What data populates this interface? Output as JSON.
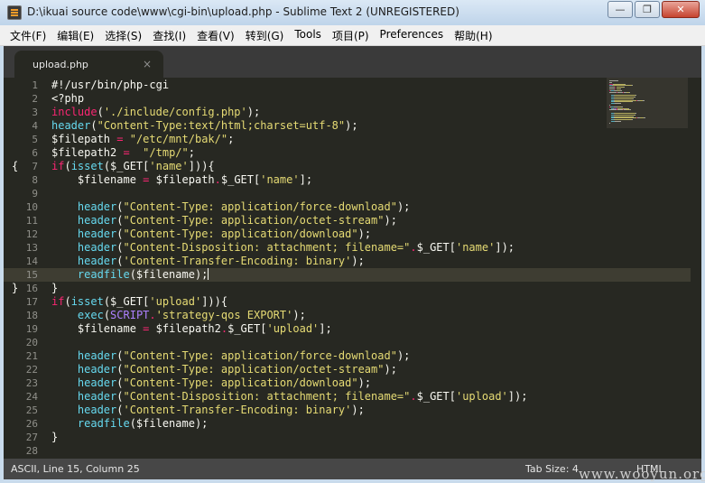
{
  "window": {
    "title": "D:\\ikuai source code\\www\\cgi-bin\\upload.php - Sublime Text 2 (UNREGISTERED)",
    "controls": {
      "minimize": "—",
      "maximize": "❐",
      "close": "✕"
    }
  },
  "menu": [
    "文件(F)",
    "编辑(E)",
    "选择(S)",
    "查找(I)",
    "查看(V)",
    "转到(G)",
    "Tools",
    "项目(P)",
    "Preferences",
    "帮助(H)"
  ],
  "tab": {
    "label": "upload.php",
    "close": "×"
  },
  "editor": {
    "current_line": 15,
    "fold_markers": [
      {
        "line": 7,
        "glyph": "{"
      },
      {
        "line": 16,
        "glyph": "}"
      }
    ],
    "lines": [
      [
        {
          "t": "#!/usr/bin/php-cgi",
          "c": "cm"
        }
      ],
      [
        {
          "t": "<?php",
          "c": "vr"
        }
      ],
      [
        {
          "t": "include",
          "c": "kw"
        },
        {
          "t": "(",
          "c": "vr"
        },
        {
          "t": "'./include/config.php'",
          "c": "st"
        },
        {
          "t": ");",
          "c": "vr"
        }
      ],
      [
        {
          "t": "header",
          "c": "fn"
        },
        {
          "t": "(",
          "c": "vr"
        },
        {
          "t": "\"Content-Type:text/html;charset=utf-8\"",
          "c": "st"
        },
        {
          "t": ");",
          "c": "vr"
        }
      ],
      [
        {
          "t": "$filepath ",
          "c": "vr"
        },
        {
          "t": "=",
          "c": "op"
        },
        {
          "t": " ",
          "c": "vr"
        },
        {
          "t": "\"/etc/mnt/bak/\"",
          "c": "st"
        },
        {
          "t": ";",
          "c": "vr"
        }
      ],
      [
        {
          "t": "$filepath2 ",
          "c": "vr"
        },
        {
          "t": "=",
          "c": "op"
        },
        {
          "t": "  ",
          "c": "vr"
        },
        {
          "t": "\"/tmp/\"",
          "c": "st"
        },
        {
          "t": ";",
          "c": "vr"
        }
      ],
      [
        {
          "t": "if",
          "c": "kw"
        },
        {
          "t": "(",
          "c": "vr"
        },
        {
          "t": "isset",
          "c": "fn"
        },
        {
          "t": "($_GET[",
          "c": "vr"
        },
        {
          "t": "'name'",
          "c": "st"
        },
        {
          "t": "])){",
          "c": "vr"
        }
      ],
      [
        {
          "t": "    $filename ",
          "c": "vr"
        },
        {
          "t": "=",
          "c": "op"
        },
        {
          "t": " $filepath",
          "c": "vr"
        },
        {
          "t": ".",
          "c": "op"
        },
        {
          "t": "$_GET[",
          "c": "vr"
        },
        {
          "t": "'name'",
          "c": "st"
        },
        {
          "t": "];",
          "c": "vr"
        }
      ],
      [],
      [
        {
          "t": "    ",
          "c": "vr"
        },
        {
          "t": "header",
          "c": "fn"
        },
        {
          "t": "(",
          "c": "vr"
        },
        {
          "t": "\"Content-Type: application/force-download\"",
          "c": "st"
        },
        {
          "t": ");",
          "c": "vr"
        }
      ],
      [
        {
          "t": "    ",
          "c": "vr"
        },
        {
          "t": "header",
          "c": "fn"
        },
        {
          "t": "(",
          "c": "vr"
        },
        {
          "t": "\"Content-Type: application/octet-stream\"",
          "c": "st"
        },
        {
          "t": ");",
          "c": "vr"
        }
      ],
      [
        {
          "t": "    ",
          "c": "vr"
        },
        {
          "t": "header",
          "c": "fn"
        },
        {
          "t": "(",
          "c": "vr"
        },
        {
          "t": "\"Content-Type: application/download\"",
          "c": "st"
        },
        {
          "t": ");",
          "c": "vr"
        }
      ],
      [
        {
          "t": "    ",
          "c": "vr"
        },
        {
          "t": "header",
          "c": "fn"
        },
        {
          "t": "(",
          "c": "vr"
        },
        {
          "t": "\"Content-Disposition: attachment; filename=\"",
          "c": "st"
        },
        {
          "t": ".",
          "c": "op"
        },
        {
          "t": "$_GET[",
          "c": "vr"
        },
        {
          "t": "'name'",
          "c": "st"
        },
        {
          "t": "]);",
          "c": "vr"
        }
      ],
      [
        {
          "t": "    ",
          "c": "vr"
        },
        {
          "t": "header",
          "c": "fn"
        },
        {
          "t": "(",
          "c": "vr"
        },
        {
          "t": "'Content-Transfer-Encoding: binary'",
          "c": "st"
        },
        {
          "t": ");",
          "c": "vr"
        }
      ],
      [
        {
          "t": "    ",
          "c": "vr"
        },
        {
          "t": "readfile",
          "c": "fn"
        },
        {
          "t": "($filename);",
          "c": "vr"
        }
      ],
      [
        {
          "t": "}",
          "c": "vr"
        }
      ],
      [
        {
          "t": "if",
          "c": "kw"
        },
        {
          "t": "(",
          "c": "vr"
        },
        {
          "t": "isset",
          "c": "fn"
        },
        {
          "t": "($_GET[",
          "c": "vr"
        },
        {
          "t": "'upload'",
          "c": "st"
        },
        {
          "t": "])){",
          "c": "vr"
        }
      ],
      [
        {
          "t": "    ",
          "c": "vr"
        },
        {
          "t": "exec",
          "c": "fn"
        },
        {
          "t": "(",
          "c": "vr"
        },
        {
          "t": "SCRIPT",
          "c": "cn"
        },
        {
          "t": ".",
          "c": "op"
        },
        {
          "t": "'strategy-qos EXPORT'",
          "c": "st"
        },
        {
          "t": ");",
          "c": "vr"
        }
      ],
      [
        {
          "t": "    $filename ",
          "c": "vr"
        },
        {
          "t": "=",
          "c": "op"
        },
        {
          "t": " $filepath2",
          "c": "vr"
        },
        {
          "t": ".",
          "c": "op"
        },
        {
          "t": "$_GET[",
          "c": "vr"
        },
        {
          "t": "'upload'",
          "c": "st"
        },
        {
          "t": "];",
          "c": "vr"
        }
      ],
      [],
      [
        {
          "t": "    ",
          "c": "vr"
        },
        {
          "t": "header",
          "c": "fn"
        },
        {
          "t": "(",
          "c": "vr"
        },
        {
          "t": "\"Content-Type: application/force-download\"",
          "c": "st"
        },
        {
          "t": ");",
          "c": "vr"
        }
      ],
      [
        {
          "t": "    ",
          "c": "vr"
        },
        {
          "t": "header",
          "c": "fn"
        },
        {
          "t": "(",
          "c": "vr"
        },
        {
          "t": "\"Content-Type: application/octet-stream\"",
          "c": "st"
        },
        {
          "t": ");",
          "c": "vr"
        }
      ],
      [
        {
          "t": "    ",
          "c": "vr"
        },
        {
          "t": "header",
          "c": "fn"
        },
        {
          "t": "(",
          "c": "vr"
        },
        {
          "t": "\"Content-Type: application/download\"",
          "c": "st"
        },
        {
          "t": ");",
          "c": "vr"
        }
      ],
      [
        {
          "t": "    ",
          "c": "vr"
        },
        {
          "t": "header",
          "c": "fn"
        },
        {
          "t": "(",
          "c": "vr"
        },
        {
          "t": "\"Content-Disposition: attachment; filename=\"",
          "c": "st"
        },
        {
          "t": ".",
          "c": "op"
        },
        {
          "t": "$_GET[",
          "c": "vr"
        },
        {
          "t": "'upload'",
          "c": "st"
        },
        {
          "t": "]);",
          "c": "vr"
        }
      ],
      [
        {
          "t": "    ",
          "c": "vr"
        },
        {
          "t": "header",
          "c": "fn"
        },
        {
          "t": "(",
          "c": "vr"
        },
        {
          "t": "'Content-Transfer-Encoding: binary'",
          "c": "st"
        },
        {
          "t": ");",
          "c": "vr"
        }
      ],
      [
        {
          "t": "    ",
          "c": "vr"
        },
        {
          "t": "readfile",
          "c": "fn"
        },
        {
          "t": "($filename);",
          "c": "vr"
        }
      ],
      [
        {
          "t": "}",
          "c": "vr"
        }
      ],
      []
    ]
  },
  "status": {
    "left": "ASCII, Line 15, Column 25",
    "tab_size": "Tab Size: 4",
    "syntax": "HTML"
  },
  "watermark": "www.wooyun.org",
  "colors": {
    "background": "#272822",
    "keyword": "#f92672",
    "function": "#66d9ef",
    "string": "#e6db74",
    "text": "#f8f8f2",
    "constant": "#ae81ff"
  }
}
